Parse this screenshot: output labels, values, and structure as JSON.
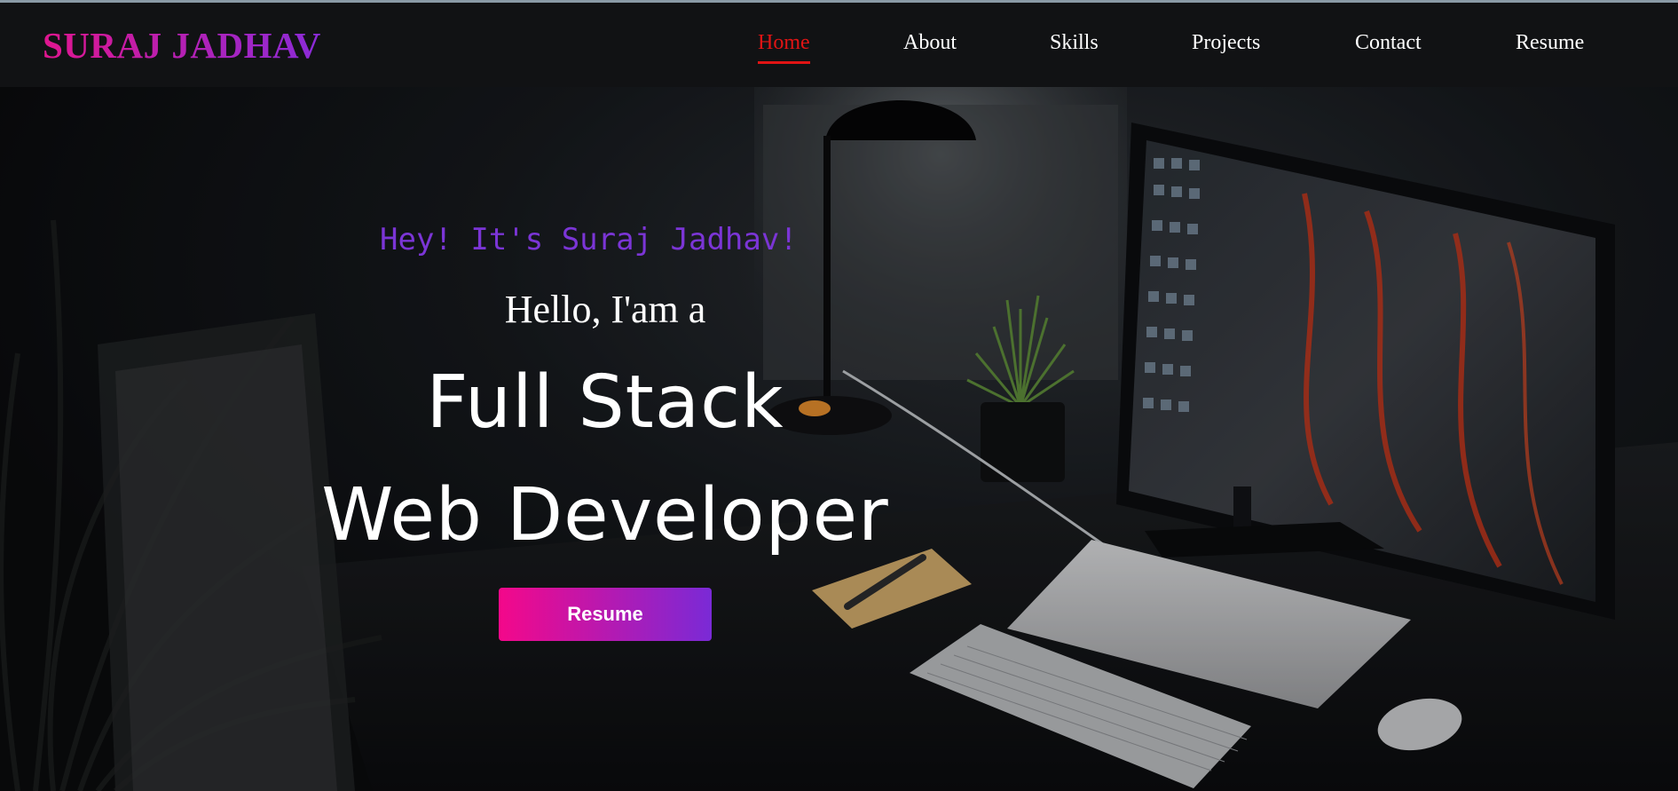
{
  "brand": {
    "name": "SURAJ JADHAV"
  },
  "nav": {
    "items": [
      {
        "label": "Home",
        "active": true
      },
      {
        "label": "About",
        "active": false
      },
      {
        "label": "Skills",
        "active": false
      },
      {
        "label": "Projects",
        "active": false
      },
      {
        "label": "Contact",
        "active": false
      },
      {
        "label": "Resume",
        "active": false
      }
    ]
  },
  "hero": {
    "greeting": "Hey! It's Suraj Jadhav!",
    "intro": "Hello, I'am a",
    "role_line1": "Full Stack",
    "role_line2": "Web Developer",
    "button_label": "Resume"
  },
  "colors": {
    "brand_gradient_start": "#e0168f",
    "brand_gradient_end": "#8a2bd8",
    "nav_active": "#e11414",
    "greeting": "#7b35d6",
    "button_gradient_start": "#f4088a",
    "button_gradient_end": "#7a2ad6"
  }
}
